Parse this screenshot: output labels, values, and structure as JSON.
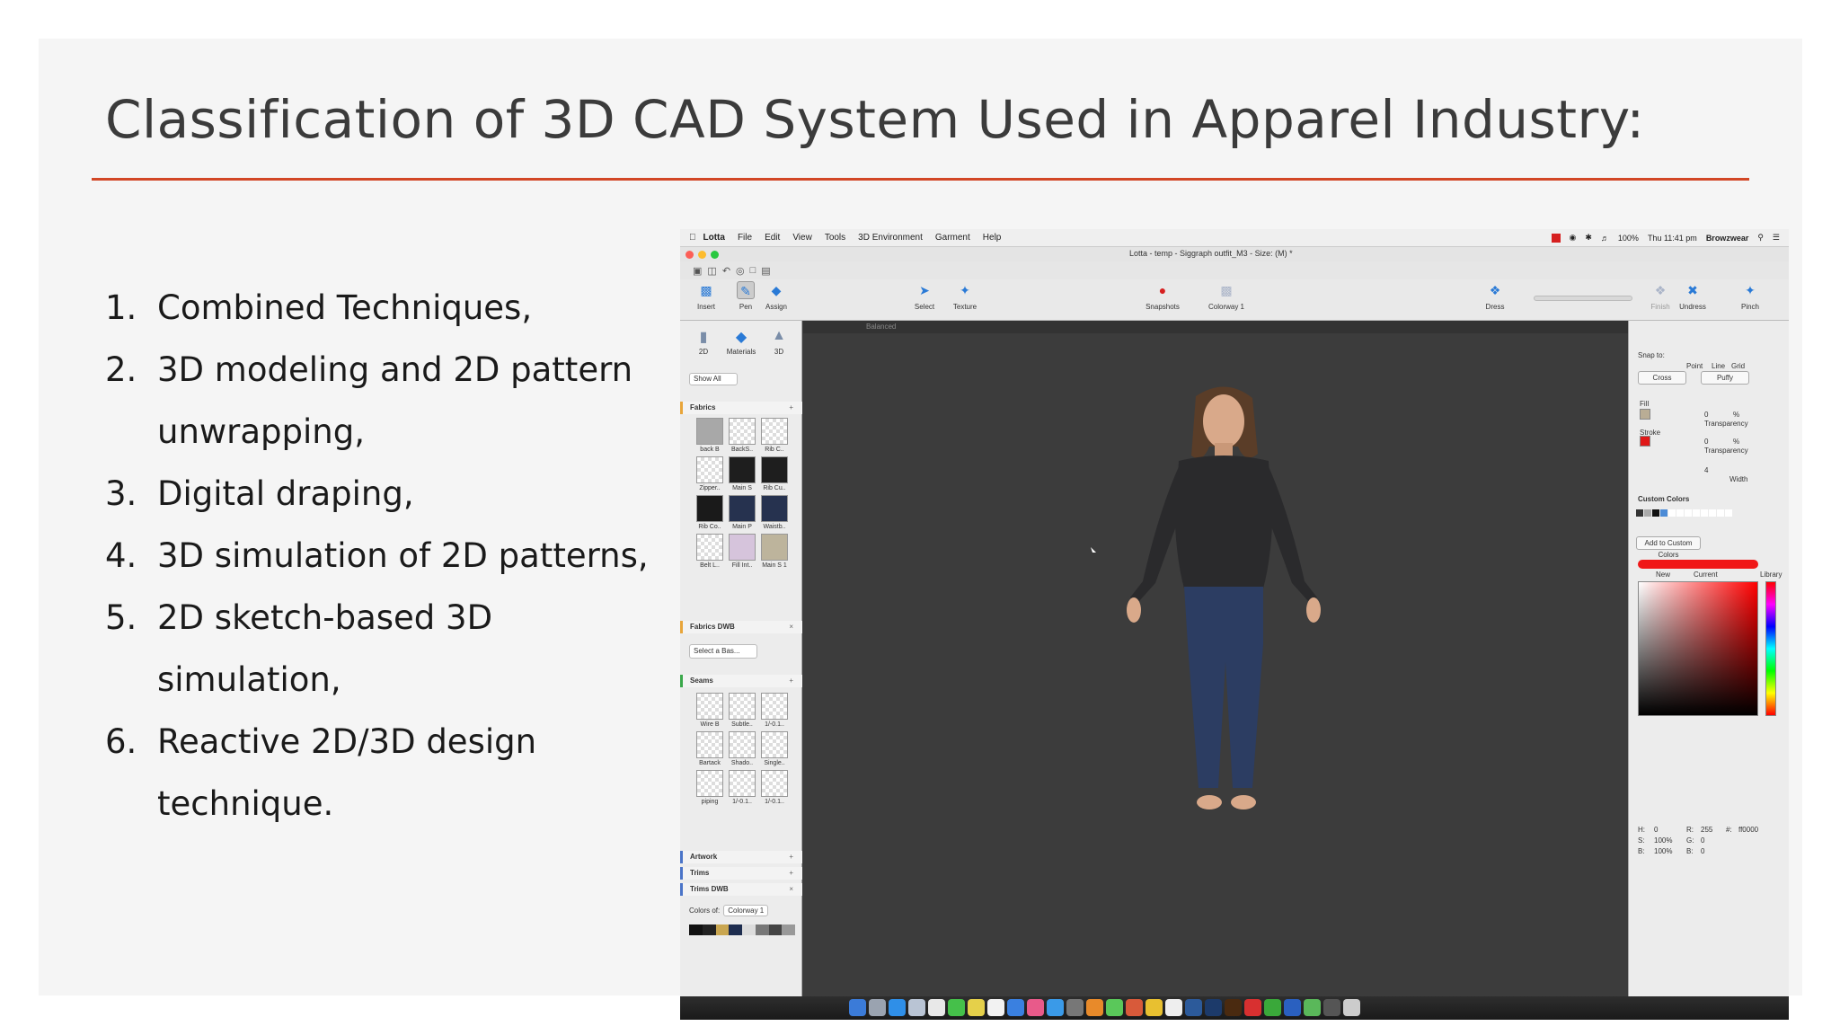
{
  "slide": {
    "title": "Classification of 3D CAD System Used in Apparel Industry:",
    "bullets": [
      {
        "num": "1.",
        "text": "Combined Techniques,"
      },
      {
        "num": "2.",
        "text": "3D modeling and 2D pattern unwrapping,"
      },
      {
        "num": "3.",
        "text": "Digital draping,"
      },
      {
        "num": "4.",
        "text": "3D simulation of 2D patterns,"
      },
      {
        "num": "5.",
        "text": "2D sketch-based 3D simulation,"
      },
      {
        "num": "6.",
        "text": "Reactive 2D/3D design technique."
      }
    ]
  },
  "app": {
    "menu": [
      "Lotta",
      "File",
      "Edit",
      "View",
      "Tools",
      "3D Environment",
      "Garment",
      "Help"
    ],
    "status": {
      "battery": "100%",
      "clock": "Thu 11:41 pm",
      "user": "Browzwear"
    },
    "window_title": "Lotta - temp - Siggraph outfit_M3 - Size: (M) *",
    "toolbar": {
      "insert": "Insert",
      "pen": "Pen",
      "assign": "Assign",
      "select": "Select",
      "texture": "Texture",
      "snapshots": "Snapshots",
      "colorway": "Colorway 1",
      "dress": "Dress",
      "finish": "Finish",
      "undress": "Undress",
      "pinch": "Pinch"
    },
    "left_panel": {
      "tabs": [
        "2D",
        "Materials",
        "3D"
      ],
      "show_all": "Show All",
      "fabrics_label": "Fabrics",
      "fabrics": [
        "back B",
        "BackS..",
        "Rib C..",
        "Zipper..",
        "Main S",
        "Rib Cu..",
        "Rib Co..",
        "Main P",
        "Waistb..",
        "Belt L..",
        "Fill Int..",
        "Main S 1"
      ],
      "fabrics_dwb": "Fabrics DWB",
      "select_base": "Select a Bas...",
      "seams_label": "Seams",
      "seams": [
        "Wire B",
        "Subtle..",
        "1/-0.1..",
        "Bartack",
        "Shado..",
        "Single..",
        "piping",
        "1/-0.1..",
        "1/-0.1.."
      ],
      "artwork": "Artwork",
      "trims": "Trims",
      "trims_dwb": "Trims DWB",
      "colors_of": "Colors of:",
      "colors_of_value": "Colorway 1"
    },
    "viewport": {
      "mode_label": "Balanced"
    },
    "right_panel": {
      "snap_to": "Snap to:",
      "snap_options": [
        "Point",
        "Line",
        "Grid"
      ],
      "cross": "Cross",
      "puffy": "Puffy",
      "fill": "Fill",
      "stroke": "Stroke",
      "transparency": "Transparency",
      "transparency_value": "0",
      "percent": "%",
      "width": "Width",
      "width_value": "4",
      "custom_colors": "Custom Colors",
      "add_custom": "Add to Custom Colors",
      "new": "New",
      "current": "Current",
      "library": "Library",
      "h_label": "H:",
      "h_value": "0",
      "s_label": "S:",
      "s_value": "100%",
      "b_label": "B:",
      "b_value": "100%",
      "r_label": "R:",
      "r_value": "255",
      "g_label": "G:",
      "g_value": "0",
      "bb_label": "B:",
      "bb_value": "0",
      "hex_label": "#:",
      "hex_value": "ff0000"
    },
    "colors": {
      "accent_rule": "#d24726",
      "shirt": "#2a2a2c",
      "jeans": "#2c3d62",
      "stroke_red": "#e01818",
      "fill_beige": "#b9ad95"
    }
  }
}
